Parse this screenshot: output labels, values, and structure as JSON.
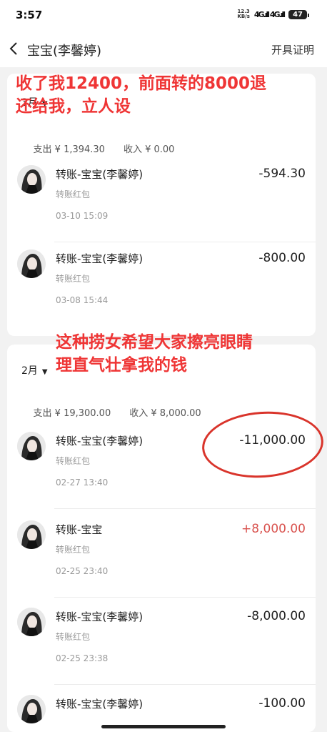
{
  "status_bar": {
    "time": "3:57",
    "net_speed_value": "12.3",
    "net_speed_unit": "KB/s",
    "signal": "4G.ıll 4G.ıll",
    "battery": "47"
  },
  "nav": {
    "title": "宝宝(李馨婷)",
    "action": "开具证明"
  },
  "annotations": {
    "top_line1": "收了我12400，前面转的8000退",
    "top_line2": "还给我，立人设",
    "mid_line1": "这种捞女希望大家擦亮眼睛",
    "mid_line2": "理直气壮拿我的钱"
  },
  "march": {
    "month": "3月",
    "expense": "支出 ¥ 1,394.30",
    "income": "收入 ¥ 0.00",
    "transactions": [
      {
        "title": "转账-宝宝(李馨婷)",
        "subtitle": "转账红包",
        "time": "03-10 15:09",
        "amount": "-594.30"
      },
      {
        "title": "转账-宝宝(李馨婷)",
        "subtitle": "转账红包",
        "time": "03-08 15:44",
        "amount": "-800.00"
      }
    ]
  },
  "february": {
    "month": "2月",
    "expense": "支出 ¥ 19,300.00",
    "income": "收入 ¥ 8,000.00",
    "transactions": [
      {
        "title": "转账-宝宝(李馨婷)",
        "subtitle": "转账红包",
        "time": "02-27 13:40",
        "amount": "-11,000.00"
      },
      {
        "title": "转账-宝宝",
        "subtitle": "转账红包",
        "time": "02-25 23:40",
        "amount": "+8,000.00"
      },
      {
        "title": "转账-宝宝(李馨婷)",
        "subtitle": "转账红包",
        "time": "02-25 23:38",
        "amount": "-8,000.00"
      },
      {
        "title": "转账-宝宝(李馨婷)",
        "subtitle": "",
        "time": "",
        "amount": "-100.00"
      }
    ]
  },
  "colors": {
    "annotation_red": "#ef3535",
    "income_red": "#d9534f"
  }
}
